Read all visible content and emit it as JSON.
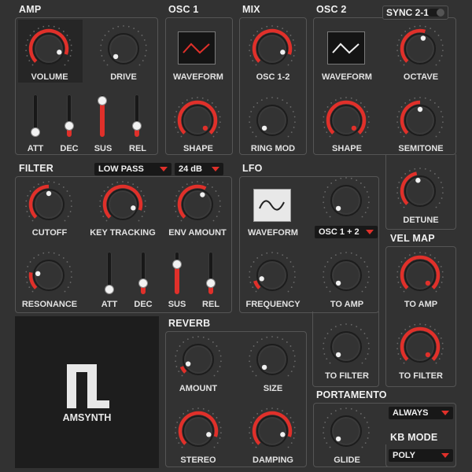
{
  "app": {
    "name": "AMSYNTH"
  },
  "colors": {
    "accent": "#e0302a",
    "panel": "#323232",
    "border": "#555555",
    "knob": "#3a3a3a"
  },
  "amp": {
    "title": "AMP",
    "volume": "VOLUME",
    "drive": "DRIVE",
    "att": "ATT",
    "dec": "DEC",
    "sus": "SUS",
    "rel": "REL"
  },
  "osc1": {
    "title": "OSC 1",
    "waveform": "WAVEFORM",
    "shape": "SHAPE"
  },
  "mix": {
    "title": "MIX",
    "osc12": "OSC 1-2",
    "ringmod": "RING MOD"
  },
  "osc2": {
    "title": "OSC 2",
    "sync": "SYNC 2-1",
    "waveform": "WAVEFORM",
    "octave": "OCTAVE",
    "shape": "SHAPE",
    "semitone": "SEMITONE",
    "detune": "DETUNE"
  },
  "filter": {
    "title": "FILTER",
    "type": "LOW PASS",
    "slope": "24 dB",
    "cutoff": "CUTOFF",
    "keytracking": "KEY TRACKING",
    "envamount": "ENV AMOUNT",
    "resonance": "RESONANCE",
    "att": "ATT",
    "dec": "DEC",
    "sus": "SUS",
    "rel": "REL"
  },
  "lfo": {
    "title": "LFO",
    "waveform": "WAVEFORM",
    "target": "OSC 1 + 2",
    "frequency": "FREQUENCY",
    "toamp": "TO AMP",
    "tofilter": "TO FILTER"
  },
  "velmap": {
    "title": "VEL MAP",
    "toamp": "TO AMP",
    "tofilter": "TO FILTER"
  },
  "reverb": {
    "title": "REVERB",
    "amount": "AMOUNT",
    "size": "SIZE",
    "stereo": "STEREO",
    "damping": "DAMPING"
  },
  "portamento": {
    "title": "PORTAMENTO",
    "mode": "ALWAYS",
    "glide": "GLIDE"
  },
  "kbmode": {
    "title": "KB MODE",
    "mode": "POLY"
  },
  "knob_values": {
    "amp_volume": 0.9,
    "amp_drive": 0.0,
    "osc1_shape": 1.0,
    "mix_osc12": 0.9,
    "mix_ringmod": 0.0,
    "osc2_octave": 0.56,
    "osc2_shape": 1.0,
    "osc2_semitone": 0.5,
    "osc2_detune": 0.46,
    "filter_cutoff": 0.5,
    "filter_keytracking": 0.9,
    "filter_envamount": 0.6,
    "filter_resonance": 0.2,
    "lfo_rate": 0.0,
    "lfo_frequency": 0.1,
    "lfo_toamp": 0.0,
    "lfo_tofilter": 0.0,
    "velmap_toamp": 1.0,
    "velmap_tofilter": 1.0,
    "reverb_amount": 0.08,
    "reverb_size": 0.0,
    "reverb_stereo": 0.9,
    "reverb_damping": 0.9,
    "portamento_glide": 0.0
  },
  "slider_values": {
    "amp_att": 0.0,
    "amp_dec": 0.2,
    "amp_sus": 1.0,
    "amp_rel": 0.2,
    "filter_att": 0.0,
    "filter_dec": 0.2,
    "filter_sus": 0.8,
    "filter_rel": 0.2
  }
}
